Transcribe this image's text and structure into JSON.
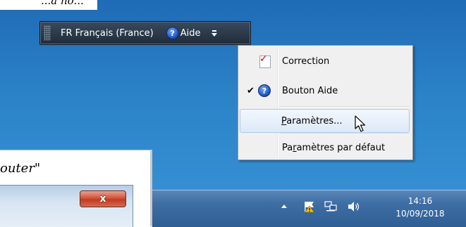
{
  "document": {
    "top_fragment": "...a no...",
    "bottom_fragment": "outer\""
  },
  "language_bar": {
    "language": "FR Français (France)",
    "help_label": "Aide",
    "help_glyph": "?"
  },
  "context_menu": {
    "items": [
      {
        "label": "Correction",
        "checked": false,
        "icon": "correction-icon"
      },
      {
        "label": "Bouton Aide",
        "checked": true,
        "icon": "help-icon"
      },
      {
        "label": "Paramètres...",
        "checked": false,
        "icon": "",
        "hover": true
      },
      {
        "label": "Paramètres par défaut",
        "checked": false,
        "icon": ""
      }
    ],
    "check_glyph": "✔"
  },
  "window": {
    "close_label": "x"
  },
  "taskbar": {
    "time": "14:16",
    "date": "10/09/2018"
  },
  "colors": {
    "desktop": "#2c84c8",
    "taskbar": "#3e6ea4",
    "menu_bg": "#f0f0f0",
    "hover": "#dde9f8",
    "close": "#c23b22"
  }
}
